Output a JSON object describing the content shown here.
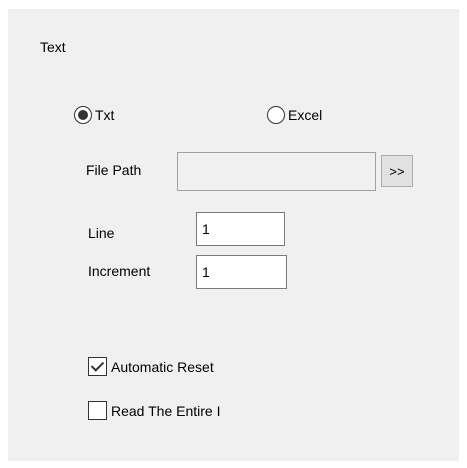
{
  "section": {
    "title": "Text"
  },
  "file_type": {
    "options": [
      {
        "label": "Txt",
        "selected": true
      },
      {
        "label": "Excel",
        "selected": false
      }
    ]
  },
  "file_path": {
    "label": "File Path",
    "value": "",
    "browse_label": ">>"
  },
  "line": {
    "label": "Line",
    "value": "1"
  },
  "increment": {
    "label": "Increment",
    "value": "1"
  },
  "options": {
    "automatic_reset": {
      "label": "Automatic Reset",
      "checked": true
    },
    "read_entire": {
      "label": "Read The Entire I",
      "checked": false
    }
  }
}
